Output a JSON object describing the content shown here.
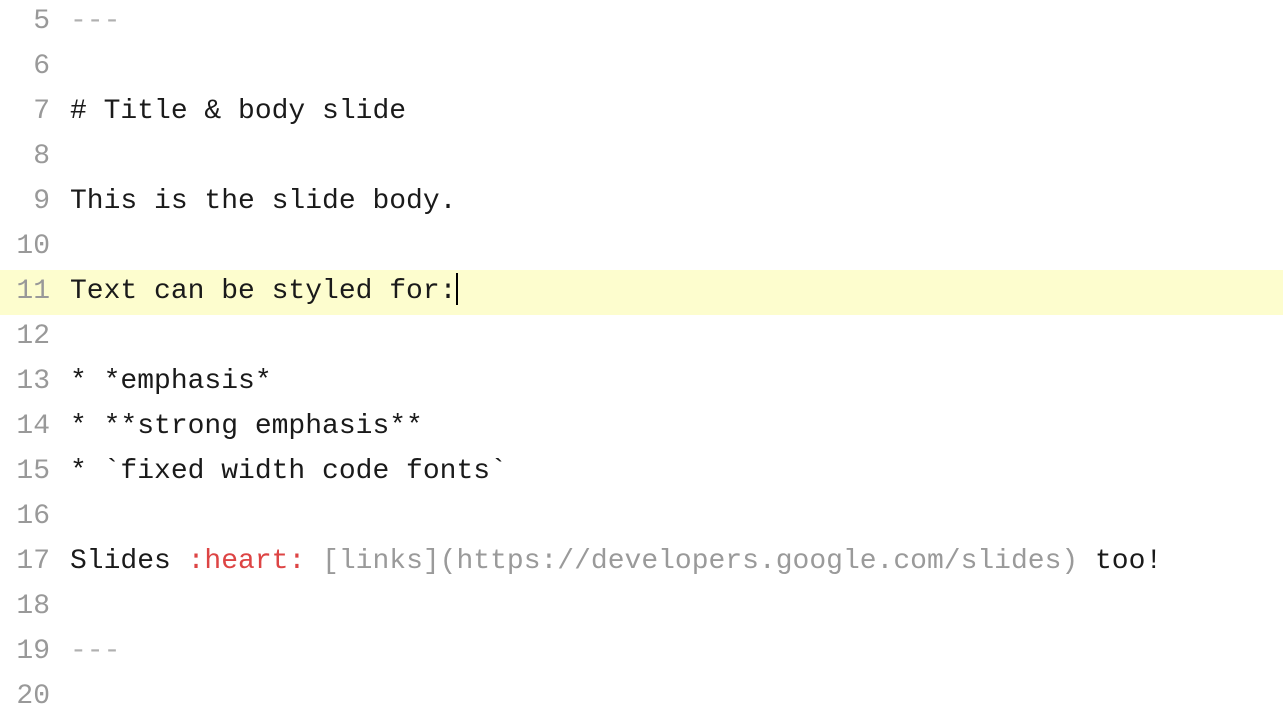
{
  "editor": {
    "startLine": 5,
    "activeLine": 11,
    "lines": [
      {
        "num": 5,
        "tokens": [
          {
            "cls": "token-gray",
            "text": "---"
          }
        ]
      },
      {
        "num": 6,
        "tokens": [
          {
            "cls": "",
            "text": ""
          }
        ]
      },
      {
        "num": 7,
        "tokens": [
          {
            "cls": "",
            "text": "# Title & body slide"
          }
        ]
      },
      {
        "num": 8,
        "tokens": [
          {
            "cls": "",
            "text": ""
          }
        ]
      },
      {
        "num": 9,
        "tokens": [
          {
            "cls": "",
            "text": "This is the slide body."
          }
        ]
      },
      {
        "num": 10,
        "tokens": [
          {
            "cls": "",
            "text": ""
          }
        ]
      },
      {
        "num": 11,
        "tokens": [
          {
            "cls": "",
            "text": "Text can be styled for:"
          }
        ],
        "cursorAfter": true
      },
      {
        "num": 12,
        "tokens": [
          {
            "cls": "",
            "text": ""
          }
        ]
      },
      {
        "num": 13,
        "tokens": [
          {
            "cls": "",
            "text": "* *emphasis*"
          }
        ]
      },
      {
        "num": 14,
        "tokens": [
          {
            "cls": "",
            "text": "* **strong emphasis**"
          }
        ]
      },
      {
        "num": 15,
        "tokens": [
          {
            "cls": "",
            "text": "* `fixed width code fonts`"
          }
        ]
      },
      {
        "num": 16,
        "tokens": [
          {
            "cls": "",
            "text": ""
          }
        ]
      },
      {
        "num": 17,
        "tokens": [
          {
            "cls": "",
            "text": "Slides "
          },
          {
            "cls": "token-red",
            "text": ":heart:"
          },
          {
            "cls": "",
            "text": " "
          },
          {
            "cls": "token-dim",
            "text": "[links](https://developers.google.com/slides)"
          },
          {
            "cls": "",
            "text": " too!"
          }
        ]
      },
      {
        "num": 18,
        "tokens": [
          {
            "cls": "",
            "text": ""
          }
        ]
      },
      {
        "num": 19,
        "tokens": [
          {
            "cls": "token-gray",
            "text": "---"
          }
        ]
      },
      {
        "num": 20,
        "tokens": [
          {
            "cls": "",
            "text": ""
          }
        ]
      }
    ]
  }
}
